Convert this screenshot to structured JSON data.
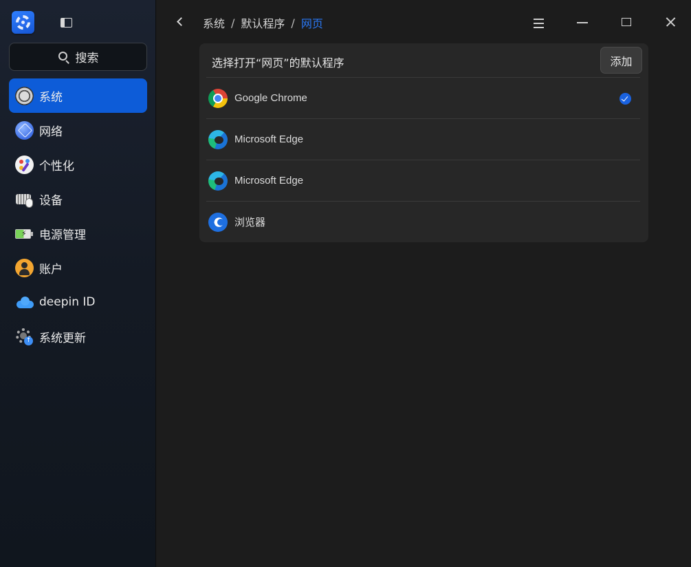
{
  "sidebar": {
    "search_placeholder": "搜索",
    "items": [
      {
        "label": "系统",
        "icon": "system-icon",
        "active": true
      },
      {
        "label": "网络",
        "icon": "network-icon"
      },
      {
        "label": "个性化",
        "icon": "personalization-icon"
      },
      {
        "label": "设备",
        "icon": "device-icon"
      },
      {
        "label": "电源管理",
        "icon": "power-icon"
      },
      {
        "label": "账户",
        "icon": "account-icon"
      },
      {
        "label": "deepin ID",
        "icon": "cloud-icon"
      },
      {
        "label": "系统更新",
        "icon": "update-icon"
      }
    ]
  },
  "breadcrumb": {
    "items": [
      "系统",
      "默认程序"
    ],
    "current": "网页",
    "separator": "/"
  },
  "panel": {
    "title": "选择打开“网页”的默认程序",
    "add_label": "添加",
    "apps": [
      {
        "name": "Google Chrome",
        "icon": "chrome-icon",
        "selected": true
      },
      {
        "name": "Microsoft Edge",
        "icon": "edge-icon"
      },
      {
        "name": "Microsoft Edge",
        "icon": "edge-icon"
      },
      {
        "name": "浏览器",
        "icon": "browser-icon"
      }
    ]
  },
  "colors": {
    "accent": "#0d5cd8",
    "breadcrumb_current": "#2a78f5",
    "check": "#1a62e0"
  }
}
